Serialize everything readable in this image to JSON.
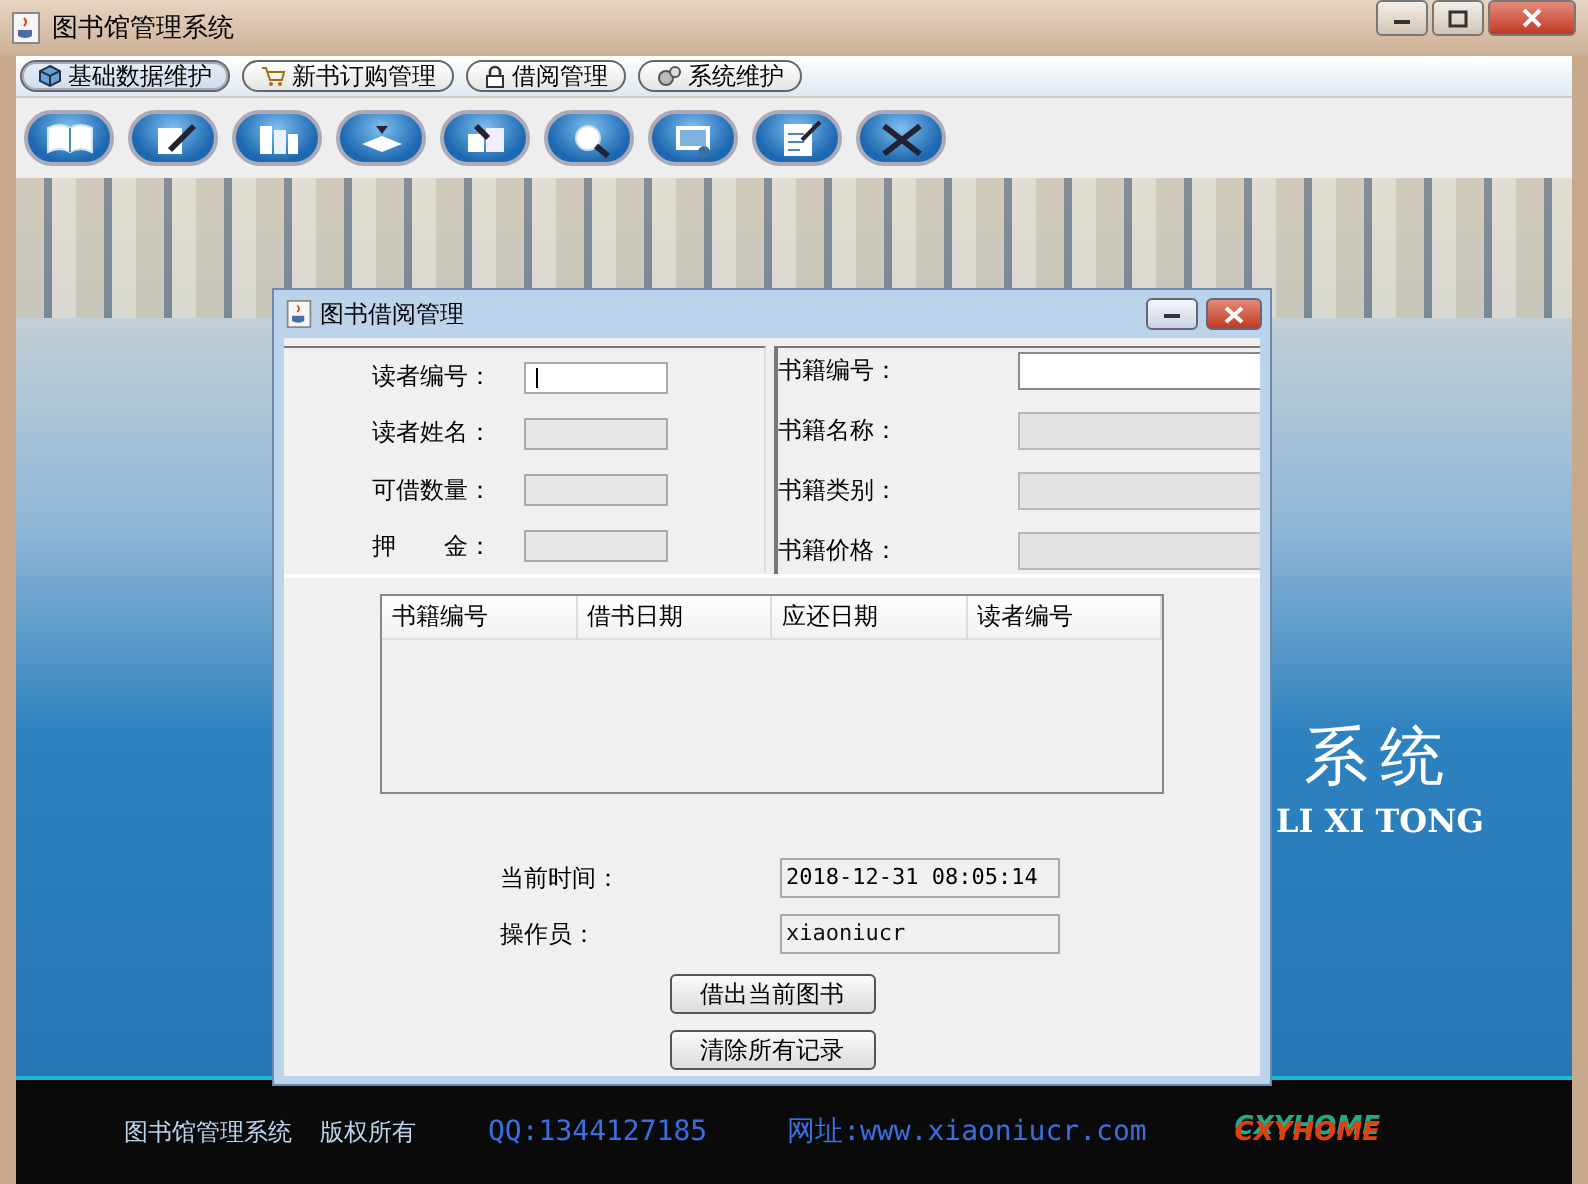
{
  "window": {
    "title": "图书馆管理系统"
  },
  "menu": [
    {
      "label": "基础数据维护",
      "selected": true
    },
    {
      "label": "新书订购管理",
      "selected": false
    },
    {
      "label": "借阅管理",
      "selected": false
    },
    {
      "label": "系统维护",
      "selected": false
    }
  ],
  "banner": {
    "title": "系统",
    "subtitle": "LI XI TONG"
  },
  "footer": {
    "name": "图书馆管理系统",
    "copyright": "版权所有",
    "qq": "QQ:1344127185",
    "website": "网址:www.xiaoniucr.com",
    "logo": "CXYHOME"
  },
  "dialog": {
    "title": "图书借阅管理",
    "reader_fields": [
      {
        "label": "读者编号：",
        "disabled": false,
        "focused": true
      },
      {
        "label": "读者姓名：",
        "disabled": true,
        "focused": false
      },
      {
        "label": "可借数量：",
        "disabled": true,
        "focused": false
      },
      {
        "label": "押　　金：",
        "disabled": true,
        "focused": false
      }
    ],
    "book_fields": [
      {
        "label": "书籍编号：",
        "disabled": false
      },
      {
        "label": "书籍名称：",
        "disabled": true
      },
      {
        "label": "书籍类别：",
        "disabled": true
      },
      {
        "label": "书籍价格：",
        "disabled": true
      }
    ],
    "table": {
      "columns": [
        "书籍编号",
        "借书日期",
        "应还日期",
        "读者编号"
      ]
    },
    "time": {
      "label": "当前时间：",
      "value": "2018-12-31 08:05:14"
    },
    "operator": {
      "label": "操作员：",
      "value": "xiaoniucr"
    },
    "buttons": [
      "借出当前图书",
      "清除所有记录"
    ]
  }
}
